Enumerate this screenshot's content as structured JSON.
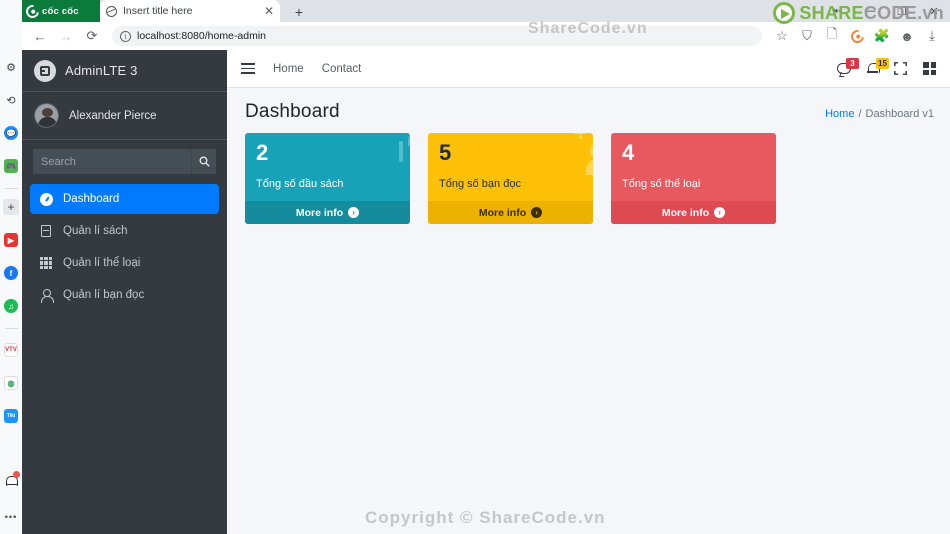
{
  "browser": {
    "brand_tab_label": "cốc cốc",
    "tab_title": "Insert title here",
    "tab_close_label": "✕",
    "new_tab_label": "+",
    "url": "localhost:8080/home-admin",
    "back_label": "←",
    "forward_label": "→",
    "reload_label": "⟳",
    "info_label": "i",
    "window_controls": {
      "restore": "⇤",
      "minimize": "—",
      "maximize": "❐",
      "close": "✕"
    },
    "toolbar_right_icons": [
      "bookmark-star-icon",
      "shield-icon",
      "reading-list-icon",
      "coccoc-shield-icon",
      "extensions-icon",
      "emoji-icon",
      "download-icon"
    ]
  },
  "rail": {
    "items": [
      {
        "name": "settings-icon",
        "glyph": "⚙"
      },
      {
        "name": "history-icon",
        "glyph": "⟲"
      },
      {
        "name": "messenger-icon",
        "glyph": ""
      },
      {
        "name": "gamepad-icon",
        "glyph": ""
      },
      {
        "name": "add-icon",
        "glyph": "+"
      },
      {
        "name": "youtube-icon",
        "glyph": "▶"
      },
      {
        "name": "facebook-icon",
        "glyph": "f"
      },
      {
        "name": "spotify-icon",
        "glyph": ""
      },
      {
        "name": "vtv-icon",
        "glyph": "VTV"
      },
      {
        "name": "coccoc-icon",
        "glyph": ""
      },
      {
        "name": "tiki-icon",
        "glyph": "Tiki"
      }
    ],
    "bottom": [
      {
        "name": "notification-bell-icon",
        "glyph": ""
      },
      {
        "name": "more-options-icon",
        "glyph": "•••"
      }
    ]
  },
  "sidebar": {
    "brand": "AdminLTE 3",
    "user": "Alexander Pierce",
    "search_placeholder": "Search",
    "search_value": "",
    "search_button_label": "🔍",
    "items": [
      {
        "label": "Dashboard",
        "icon": "tachometer-icon",
        "active": true
      },
      {
        "label": "Quản lí sách",
        "icon": "book-icon",
        "active": false
      },
      {
        "label": "Quản lí thể loại",
        "icon": "grid-icon",
        "active": false
      },
      {
        "label": "Quản lí bạn đọc",
        "icon": "user-icon",
        "active": false
      }
    ]
  },
  "navbar": {
    "menu_toggle": "hamburger-icon",
    "links": [
      "Home",
      "Contact"
    ],
    "messages_badge": "3",
    "notifications_badge": "15",
    "fullscreen_icon": "expand-icon",
    "controls_icon": "grid-squares-icon"
  },
  "content": {
    "page_title": "Dashboard",
    "breadcrumb": {
      "home": "Home",
      "separator": "/",
      "current": "Dashboard v1"
    },
    "cards": [
      {
        "number": "2",
        "label": "Tổng số đầu sách",
        "footer": "More info",
        "color": "#17a2b8",
        "footer_color": "#148c9e",
        "text_color": "#ffffff",
        "icon": "shopping-bag-icon"
      },
      {
        "number": "5",
        "label": "Tổng số bạn đọc",
        "footer": "More info",
        "color": "#ffc107",
        "footer_color": "#edb100",
        "text_color": "#1f2d3d",
        "icon": "user-plus-icon"
      },
      {
        "number": "4",
        "label": "Tổng số thể loại",
        "footer": "More info",
        "color": "#dc3545",
        "footer_color": "#d33b48",
        "text_color": "#ffffff",
        "icon": "pie-chart-icon"
      }
    ],
    "arrow_glyph": "➔"
  },
  "watermarks": {
    "url_bar": "ShareCode.vn",
    "footer": "Copyright © ShareCode.vn",
    "logo_share": "SHARE",
    "logo_code": "CODE.vn"
  }
}
